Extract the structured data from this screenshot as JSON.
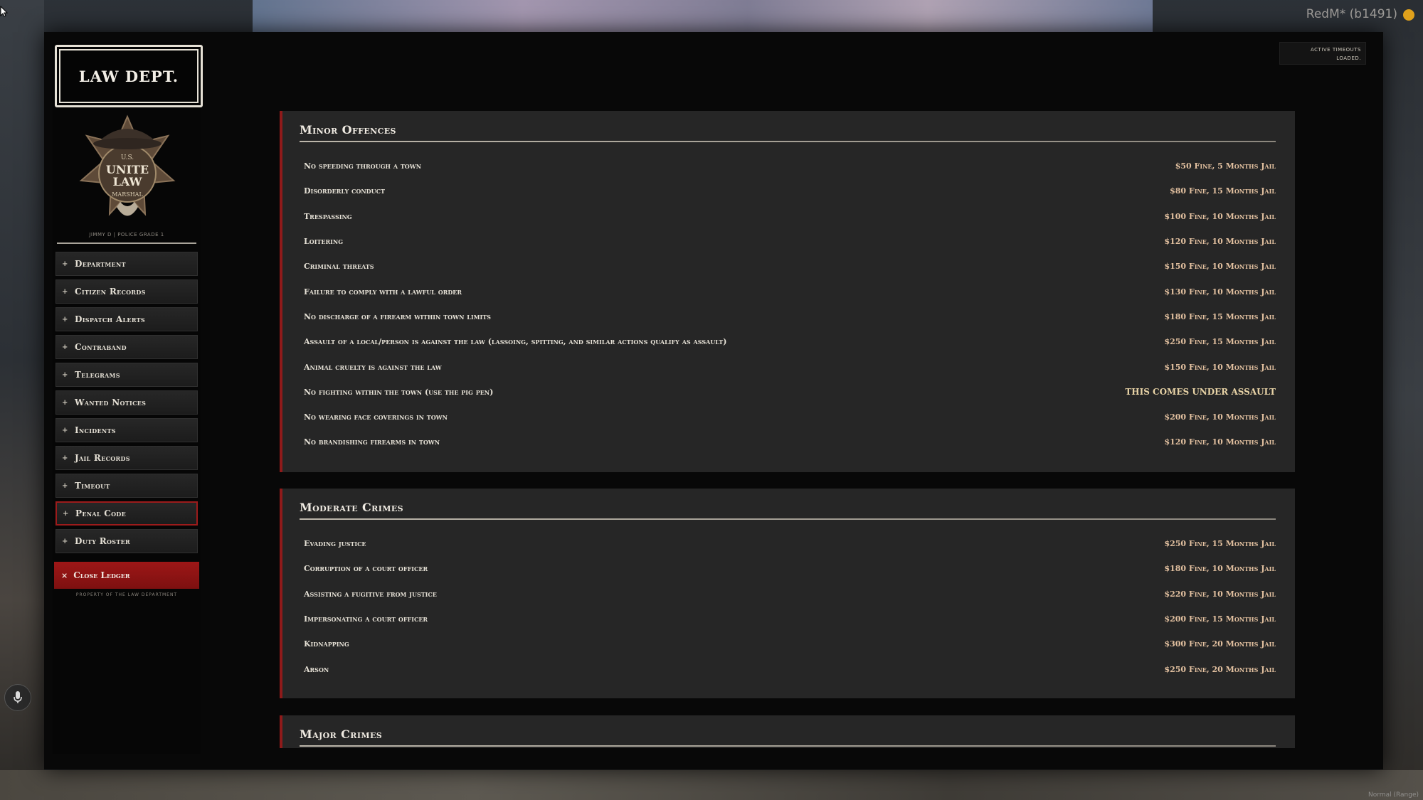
{
  "overlay": {
    "title": "RedM* (b1491)",
    "corner_text": "Normal (Range)"
  },
  "sidebar": {
    "brand_title": "LAW DEPT.",
    "badge": {
      "top_text": "U.S.",
      "main_line1": "UNITE",
      "main_line2": "LAW",
      "bottom_text": "MARSHAL"
    },
    "user_line": "JIMMY D | POLICE GRADE 1",
    "items": [
      {
        "label": "Department",
        "active": false
      },
      {
        "label": "Citizen Records",
        "active": false
      },
      {
        "label": "Dispatch Alerts",
        "active": false
      },
      {
        "label": "Contraband",
        "active": false
      },
      {
        "label": "Telegrams",
        "active": false
      },
      {
        "label": "Wanted Notices",
        "active": false
      },
      {
        "label": "Incidents",
        "active": false
      },
      {
        "label": "Jail Records",
        "active": false
      },
      {
        "label": "Timeout",
        "active": false
      },
      {
        "label": "Penal Code",
        "active": true
      },
      {
        "label": "Duty Roster",
        "active": false
      }
    ],
    "item_icon": "+",
    "close_icon": "×",
    "close_label": "Close Ledger",
    "property_line": "PROPERTY OF THE LAW DEPARTMENT"
  },
  "status": {
    "line1": "ACTIVE TIMEOUTS",
    "line2": "LOADED."
  },
  "sections": [
    {
      "title": "Minor Offences",
      "rows": [
        {
          "offence": "No speeding through a town",
          "penalty": "$50 Fine, 5 Months Jail"
        },
        {
          "offence": "Disorderly conduct",
          "penalty": "$80 Fine, 15 Months Jail"
        },
        {
          "offence": "Trespassing",
          "penalty": "$100 Fine, 10 Months Jail"
        },
        {
          "offence": "Loitering",
          "penalty": "$120 Fine, 10 Months Jail"
        },
        {
          "offence": "Criminal threats",
          "penalty": "$150 Fine, 10 Months Jail"
        },
        {
          "offence": "Failure to comply with a lawful order",
          "penalty": "$130 Fine, 10 Months Jail"
        },
        {
          "offence": "No discharge of a firearm within town limits",
          "penalty": "$180 Fine, 15 Months Jail"
        },
        {
          "offence": "Assault of a local/person is against the law (lassoing, spitting, and similar actions qualify as assault)",
          "penalty": "$250 Fine, 15 Months Jail"
        },
        {
          "offence": "Animal cruelty is against the law",
          "penalty": "$150 Fine, 10 Months Jail"
        },
        {
          "offence": "No fighting within the town (use the pig pen)",
          "penalty": "THIS COMES UNDER ASSAULT",
          "special": true
        },
        {
          "offence": "No wearing face coverings in town",
          "penalty": "$200 Fine, 10 Months Jail"
        },
        {
          "offence": "No brandishing firearms in town",
          "penalty": "$120 Fine, 10 Months Jail"
        }
      ]
    },
    {
      "title": "Moderate Crimes",
      "rows": [
        {
          "offence": "Evading justice",
          "penalty": "$250 Fine, 15 Months Jail"
        },
        {
          "offence": "Corruption of a court officer",
          "penalty": "$180 Fine, 10 Months Jail"
        },
        {
          "offence": "Assisting a fugitive from justice",
          "penalty": "$220 Fine, 10 Months Jail"
        },
        {
          "offence": "Impersonating a court officer",
          "penalty": "$200 Fine, 15 Months Jail"
        },
        {
          "offence": "Kidnapping",
          "penalty": "$300 Fine, 20 Months Jail"
        },
        {
          "offence": "Arson",
          "penalty": "$250 Fine, 20 Months Jail"
        }
      ]
    },
    {
      "title": "Major Crimes",
      "rows": []
    }
  ],
  "colors": {
    "accent_red": "#8f1a1a",
    "close_red": "#9e1717",
    "penalty_text": "#e3c1a0",
    "panel_bg": "#262626"
  }
}
